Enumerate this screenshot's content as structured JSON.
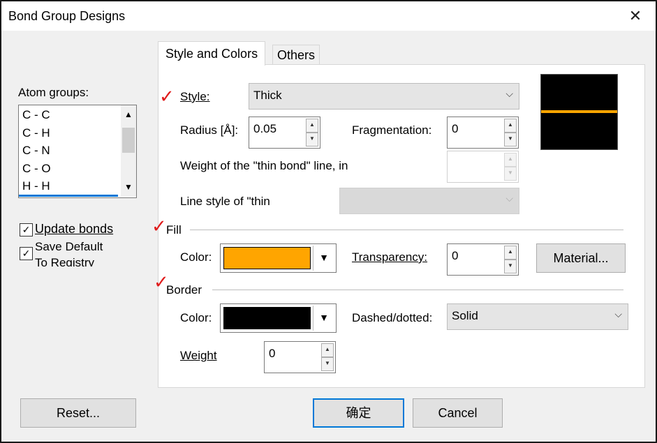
{
  "window": {
    "title": "Bond Group Designs"
  },
  "tabs": [
    {
      "label": "Style and Colors"
    },
    {
      "label": "Others"
    }
  ],
  "atom_groups": {
    "label": "Atom groups:",
    "items": [
      "C - C",
      "C - H",
      "C - N",
      "C - O",
      "H - H"
    ]
  },
  "checks": {
    "update_bonds": "Update bonds",
    "save_default_line1": "Save Default",
    "save_default_line2": "To Registry"
  },
  "style": {
    "label": "Style:",
    "value": "Thick"
  },
  "radius": {
    "label": "Radius [Å]:",
    "value": "0.05"
  },
  "fragmentation": {
    "label": "Fragmentation:",
    "value": "0"
  },
  "thin_weight": {
    "label": "Weight of the \"thin bond\" line, in",
    "value": ""
  },
  "thin_style": {
    "label": "Line style of \"thin",
    "value": ""
  },
  "fill": {
    "header": "Fill",
    "color_label": "Color:",
    "color": "#ffa500",
    "transparency_label": "Transparency:",
    "transparency": "0",
    "material_button": "Material..."
  },
  "border": {
    "header": "Border",
    "color_label": "Color:",
    "color": "#000000",
    "dashed_label": "Dashed/dotted:",
    "dashed_value": "Solid",
    "weight_label": "Weight",
    "weight_value": "0"
  },
  "preview": {
    "background": "#000000",
    "line_color": "#ffa500"
  },
  "buttons": {
    "reset": "Reset...",
    "ok": "确定",
    "cancel": "Cancel"
  },
  "annotations": {
    "mark_glyph": "✓",
    "mark_color": "#e01b1b"
  }
}
